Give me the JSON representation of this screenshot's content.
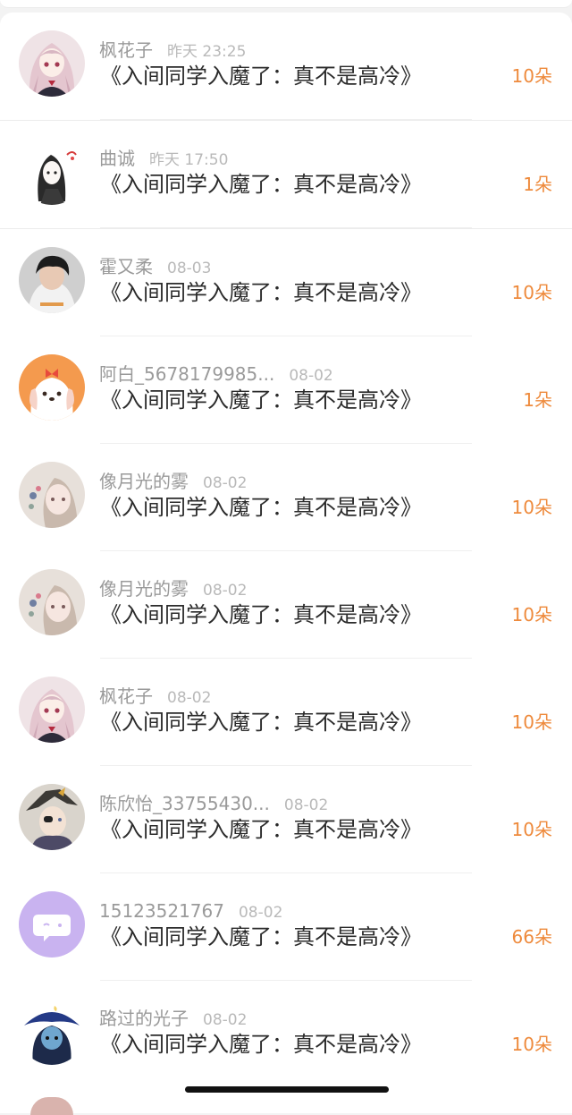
{
  "book_title": "《入间同学入魔了：真不是高冷》",
  "unit": "朵",
  "rows": [
    {
      "name": "枫花子",
      "time": "昨天 23:25",
      "amount": "10朵",
      "avatar": "anime-girl-pink-hair-avatar"
    },
    {
      "name": "曲诚",
      "time": "昨天 17:50",
      "amount": "1朵",
      "avatar": "sketch-girl-avatar"
    },
    {
      "name": "霍又柔",
      "time": "08-03",
      "amount": "10朵",
      "avatar": "photo-boy-avatar"
    },
    {
      "name": "阿白_5678179985...",
      "time": "08-02",
      "amount": "1朵",
      "avatar": "cartoon-puppy-avatar"
    },
    {
      "name": "像月光的雾",
      "time": "08-02",
      "amount": "10朵",
      "avatar": "anime-girl-floral-avatar"
    },
    {
      "name": "像月光的雾",
      "time": "08-02",
      "amount": "10朵",
      "avatar": "anime-girl-floral-avatar"
    },
    {
      "name": "枫花子",
      "time": "08-02",
      "amount": "10朵",
      "avatar": "anime-girl-pink-hair-avatar"
    },
    {
      "name": "陈欣怡_33755430...",
      "time": "08-02",
      "amount": "10朵",
      "avatar": "anime-pirate-avatar"
    },
    {
      "name": "15123521767",
      "time": "08-02",
      "amount": "66朵",
      "avatar": "default-purple-chat-avatar"
    },
    {
      "name": "路过的光子",
      "time": "08-02",
      "amount": "10朵",
      "avatar": "anime-witch-hat-avatar"
    }
  ],
  "colors": {
    "amount": "#ee8a3c",
    "name": "#9a9a9a",
    "time": "#b9b9b9",
    "title": "#2b2b2b",
    "default_avatar": "#c9b3f0"
  }
}
